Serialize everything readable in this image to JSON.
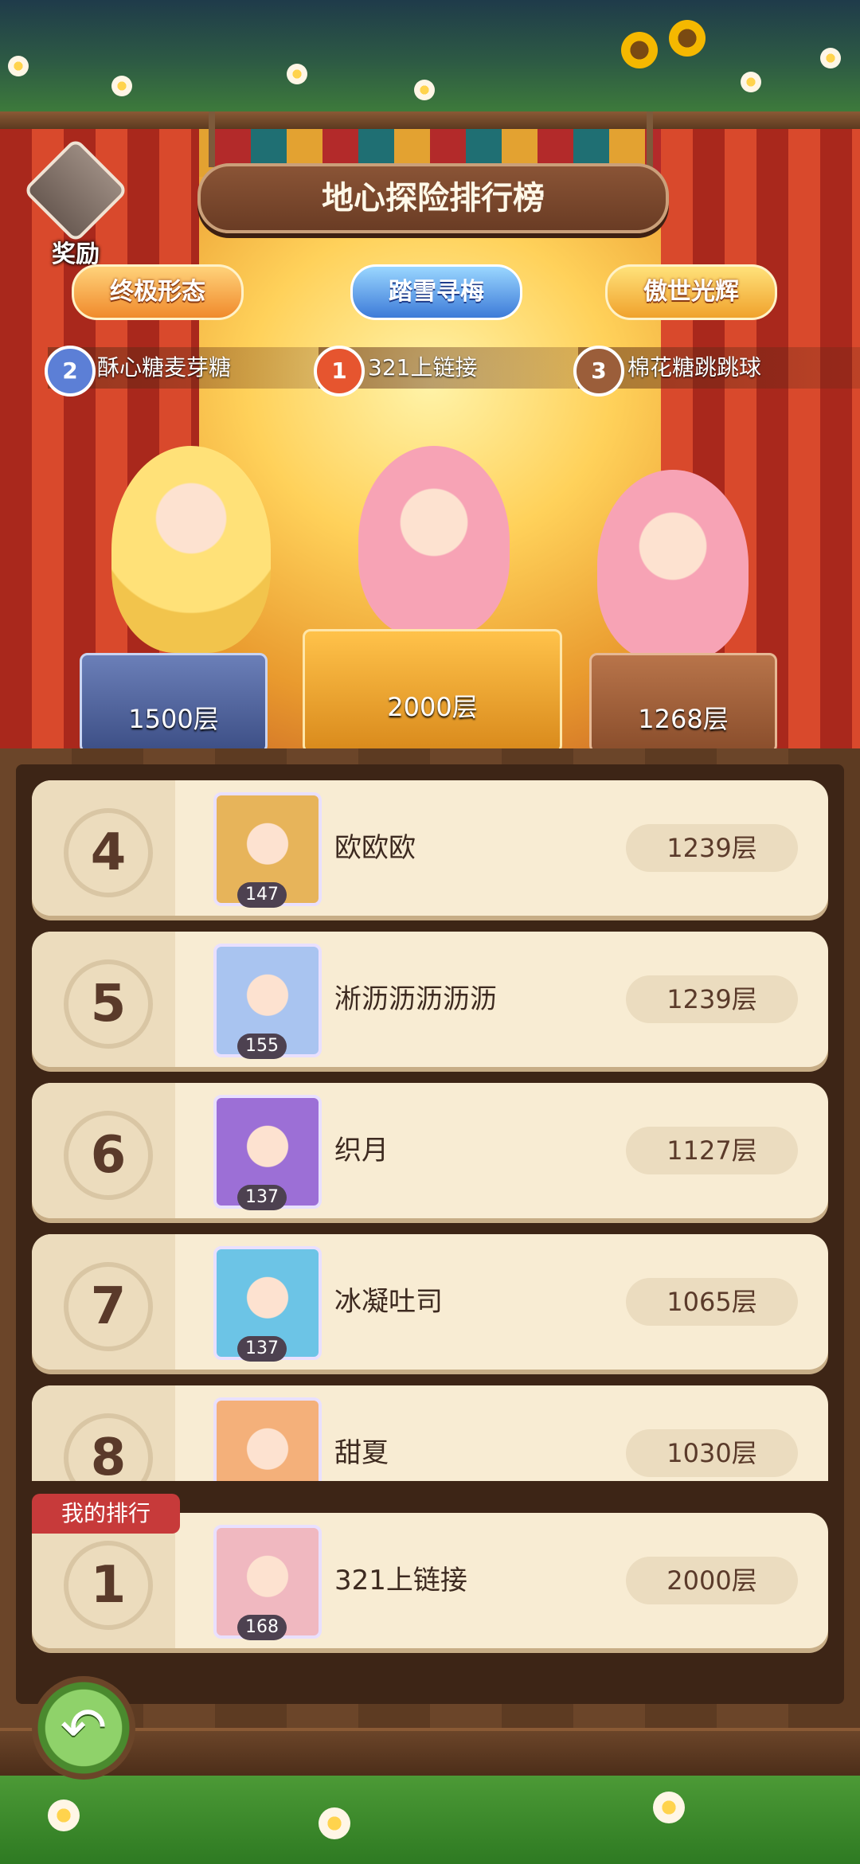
{
  "header": {
    "title": "地心探险排行榜",
    "reward_label": "奖励"
  },
  "badges": [
    "终极形态",
    "踏雪寻梅",
    "傲世光辉"
  ],
  "podium": [
    {
      "rank": "2",
      "name": "酥心糖麦芽糖",
      "score": "1500层"
    },
    {
      "rank": "1",
      "name": "321上链接",
      "score": "2000层"
    },
    {
      "rank": "3",
      "name": "棉花糖跳跳球",
      "score": "1268层"
    }
  ],
  "list": [
    {
      "rank": "4",
      "name": "欧欧欧",
      "level": "147",
      "score": "1239层",
      "avatar_color": "#e7b45a"
    },
    {
      "rank": "5",
      "name": "淅沥沥沥沥沥",
      "level": "155",
      "score": "1239层",
      "avatar_color": "#a9c4f0"
    },
    {
      "rank": "6",
      "name": "织月",
      "level": "137",
      "score": "1127层",
      "avatar_color": "#9c6fd6"
    },
    {
      "rank": "7",
      "name": "冰凝吐司",
      "level": "137",
      "score": "1065层",
      "avatar_color": "#6cc4e6"
    },
    {
      "rank": "8",
      "name": "甜夏",
      "level": "",
      "score": "1030层",
      "avatar_color": "#f4b07a"
    }
  ],
  "my_rank": {
    "label": "我的排行",
    "rank": "1",
    "name": "321上链接",
    "level": "168",
    "score": "2000层",
    "avatar_color": "#f0b8c0"
  },
  "icons": {
    "back": "back-arrow-icon",
    "gift": "gift-icon"
  }
}
